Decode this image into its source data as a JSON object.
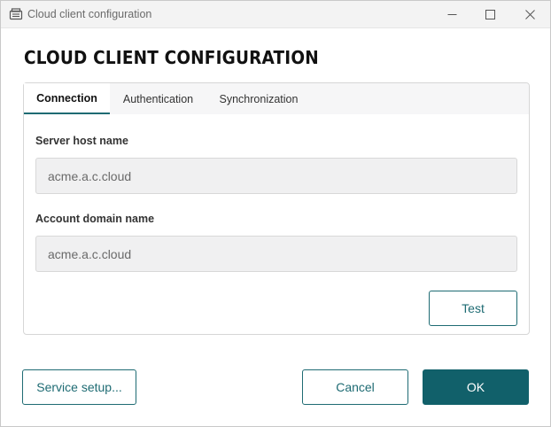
{
  "window": {
    "title": "Cloud client configuration",
    "icon": "window-app-icon"
  },
  "heading": "CLOUD CLIENT CONFIGURATION",
  "tabs": [
    {
      "label": "Connection",
      "active": true
    },
    {
      "label": "Authentication",
      "active": false
    },
    {
      "label": "Synchronization",
      "active": false
    }
  ],
  "connection": {
    "server_label": "Server host name",
    "server_value": "acme.a.c.cloud",
    "domain_label": "Account domain name",
    "domain_value": "acme.a.c.cloud",
    "test_label": "Test"
  },
  "footer": {
    "service_setup_label": "Service setup...",
    "cancel_label": "Cancel",
    "ok_label": "OK"
  },
  "colors": {
    "accent": "#11606a",
    "input_bg": "#f0f0f1"
  }
}
